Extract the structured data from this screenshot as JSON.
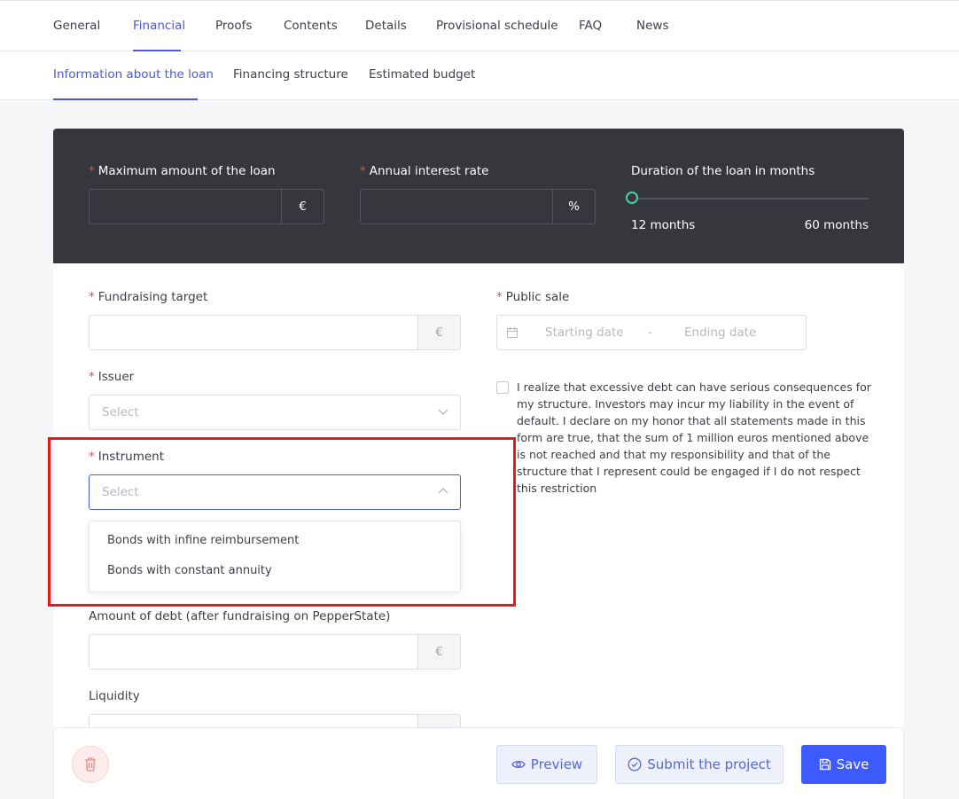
{
  "top_tabs": [
    "General",
    "Financial",
    "Proofs",
    "Contents",
    "Details",
    "Provisional schedule",
    "FAQ",
    "News"
  ],
  "active_top_tab": "Financial",
  "sub_tabs": [
    "Information about the loan",
    "Financing structure",
    "Estimated budget"
  ],
  "active_sub_tab": "Information about the loan",
  "loan": {
    "max_amount_label": "Maximum amount of the loan",
    "max_amount_value": "",
    "max_amount_unit": "€",
    "interest_label": "Annual interest rate",
    "interest_value": "",
    "interest_unit": "%",
    "duration_label": "Duration of the loan in months",
    "duration_min": "12 months",
    "duration_max": "60 months"
  },
  "form": {
    "fundraising_label": "Fundraising target",
    "fundraising_unit": "€",
    "issuer_label": "Issuer",
    "issuer_placeholder": "Select",
    "instrument_label": "Instrument",
    "instrument_placeholder": "Select",
    "instrument_options": [
      "Bonds with infine reimbursement",
      "Bonds with constant annuity"
    ],
    "debt_label": "Amount of debt (after fundraising on PepperState)",
    "debt_unit": "€",
    "liquidity_label": "Liquidity",
    "public_sale_label": "Public sale",
    "start_date_placeholder": "Starting date",
    "date_separator": "-",
    "end_date_placeholder": "Ending date",
    "disclaimer": "I realize that excessive debt can have serious consequences for my structure. Investors may incur my liability in the event of default. I declare on my honor that all statements made in this form are true, that the sum of 1 million euros mentioned above is not reached and that my responsibility and that of the structure that I represent could be engaged if I do not respect this restriction"
  },
  "footer": {
    "preview_label": "Preview",
    "submit_label": "Submit the project",
    "save_label": "Save"
  },
  "required_marker": "*",
  "colors": {
    "accent": "#4b5bd6",
    "primary_button": "#3d5afe",
    "dark_panel": "#36363d",
    "required": "#e84a4a",
    "slider_handle": "#48d1a8",
    "highlight": "#e8191d"
  }
}
